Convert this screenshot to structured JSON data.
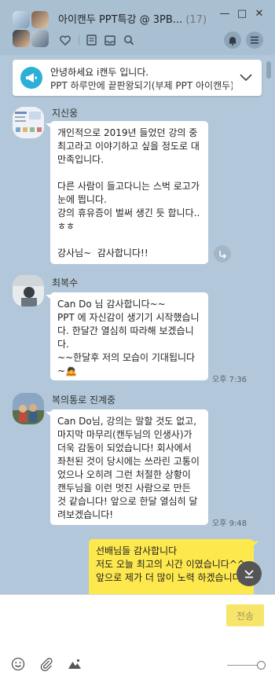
{
  "window": {
    "title": "아이캔두 PPT특강 @ 3PB...",
    "member_count": "(17)",
    "minimize_symbol": "—",
    "maximize_symbol": "□",
    "close_symbol": "✕"
  },
  "toolbar": {
    "icons": [
      "heart-icon",
      "note-icon",
      "inbox-icon",
      "search-icon"
    ],
    "right_icons": [
      "bell-icon",
      "menu-icon"
    ]
  },
  "notice": {
    "line1": "안녕하세요 i캔두 입니다.",
    "line2": "PPT 하루만에 끝판왕되기(부제 PPT 아이캔두) 단톡방입니다"
  },
  "messages": [
    {
      "sender": "지신웅",
      "text": "개인적으로 2019년 들었던 강의 중 최고라고 이야기하고 싶을 정도로 대만족입니다.\n\n다른 사람이 들고다니는 스벅 로고가 눈에 띕니다.\n강의 휴유증이 벌써 생긴 듯 합니다..ㅎㅎ\n\n강사님~  감사합니다!!",
      "time": ""
    },
    {
      "sender": "최복수",
      "text": "Can Do 님 감사합니다~~\nPPT 에 자신감이 생기기 시작했습니다. 한달간 열심히 따라해 보겠습니다.\n~~한달후 저의 모습이 기대됩니다 ~🙇",
      "time": "오후 7:36"
    },
    {
      "sender": "복의통로 진계중",
      "text": "Can Do님, 강의는 말할 것도 없고, 마지막 마무리(캔두님의 인생사)가 더욱 감동이 되었습니다! 회사에서 좌천된 것이 당시에는 쓰라린 고통이었으나 오히려 그런 처절한 상황이 캔두님을 이런 멋진 사람으로 만든 것 같습니다! 앞으로 한달 열심히 달려보겠습니다!",
      "time": "오후 9:48"
    },
    {
      "sender": "",
      "text": "선배님들 감사합니다\n저도 오늘 최고의 시간 이였습니다^^\n앞으로 제가 더 많이 노력 하겠습니다",
      "time": ""
    }
  ],
  "input": {
    "send_label": "전송"
  },
  "colors": {
    "chat_background": "#b2c7d9",
    "my_bubble": "#fde84d",
    "notice_icon": "#2cb0d6"
  }
}
